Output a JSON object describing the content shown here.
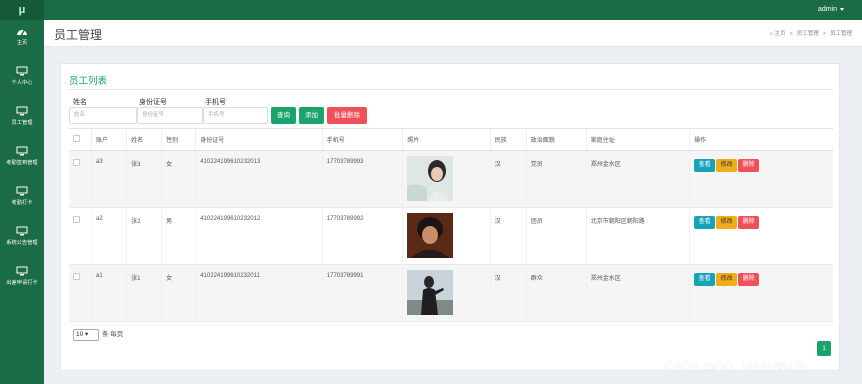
{
  "topbar": {
    "logo": "μ",
    "user": "admin"
  },
  "sidebar": {
    "items": [
      {
        "label": "主页",
        "icon": "dashboard-icon"
      },
      {
        "label": "个人中心",
        "icon": "monitor-icon"
      },
      {
        "label": "员工管理",
        "icon": "monitor-icon"
      },
      {
        "label": "考勤签到管理",
        "icon": "monitor-icon"
      },
      {
        "label": "考勤打卡",
        "icon": "monitor-icon"
      },
      {
        "label": "系统公告管理",
        "icon": "monitor-icon"
      },
      {
        "label": "出差申请打卡",
        "icon": "monitor-icon"
      }
    ]
  },
  "header": {
    "title": "员工管理",
    "breadcrumb": [
      "主页",
      "员工管理",
      "员工管理"
    ]
  },
  "card": {
    "title": "员工列表"
  },
  "search": {
    "name_label": "姓名",
    "name_placeholder": "姓名",
    "id_label": "身份证号",
    "id_placeholder": "身份证号",
    "phone_label": "手机号",
    "phone_placeholder": "手机号",
    "query_btn": "查询",
    "add_btn": "添加",
    "batch_delete_btn": "批量删除"
  },
  "table": {
    "headers": [
      "",
      "账户",
      "姓名",
      "性别",
      "身份证号",
      "手机号",
      "照片",
      "民族",
      "政治面貌",
      "家庭住址",
      "操作"
    ],
    "rows": [
      {
        "account": "a3",
        "name": "张3",
        "gender": "女",
        "id_no": "410224199610232013",
        "phone": "17703789993",
        "ethnic": "汉",
        "political": "党员",
        "address": "郑州金水区"
      },
      {
        "account": "a2",
        "name": "张2",
        "gender": "男",
        "id_no": "410224199610232012",
        "phone": "17703789992",
        "ethnic": "汉",
        "political": "团员",
        "address": "北京市朝阳区朝阳路"
      },
      {
        "account": "a1",
        "name": "张1",
        "gender": "女",
        "id_no": "410224199610232011",
        "phone": "17703789991",
        "ethnic": "汉",
        "political": "群众",
        "address": "郑州金水区"
      }
    ],
    "actions": {
      "view": "查看",
      "edit": "修改",
      "delete": "删除"
    }
  },
  "pagination": {
    "page_size": "10",
    "per_page_text": "条 每页",
    "current_page": "1"
  },
  "watermark": "CSDN @QQ_1963288475",
  "colors": {
    "theme_green": "#1b6b46",
    "accent_green": "#1aa36b",
    "info": "#17a2b8",
    "warning": "#f0ad1a",
    "danger": "#f0505a"
  }
}
